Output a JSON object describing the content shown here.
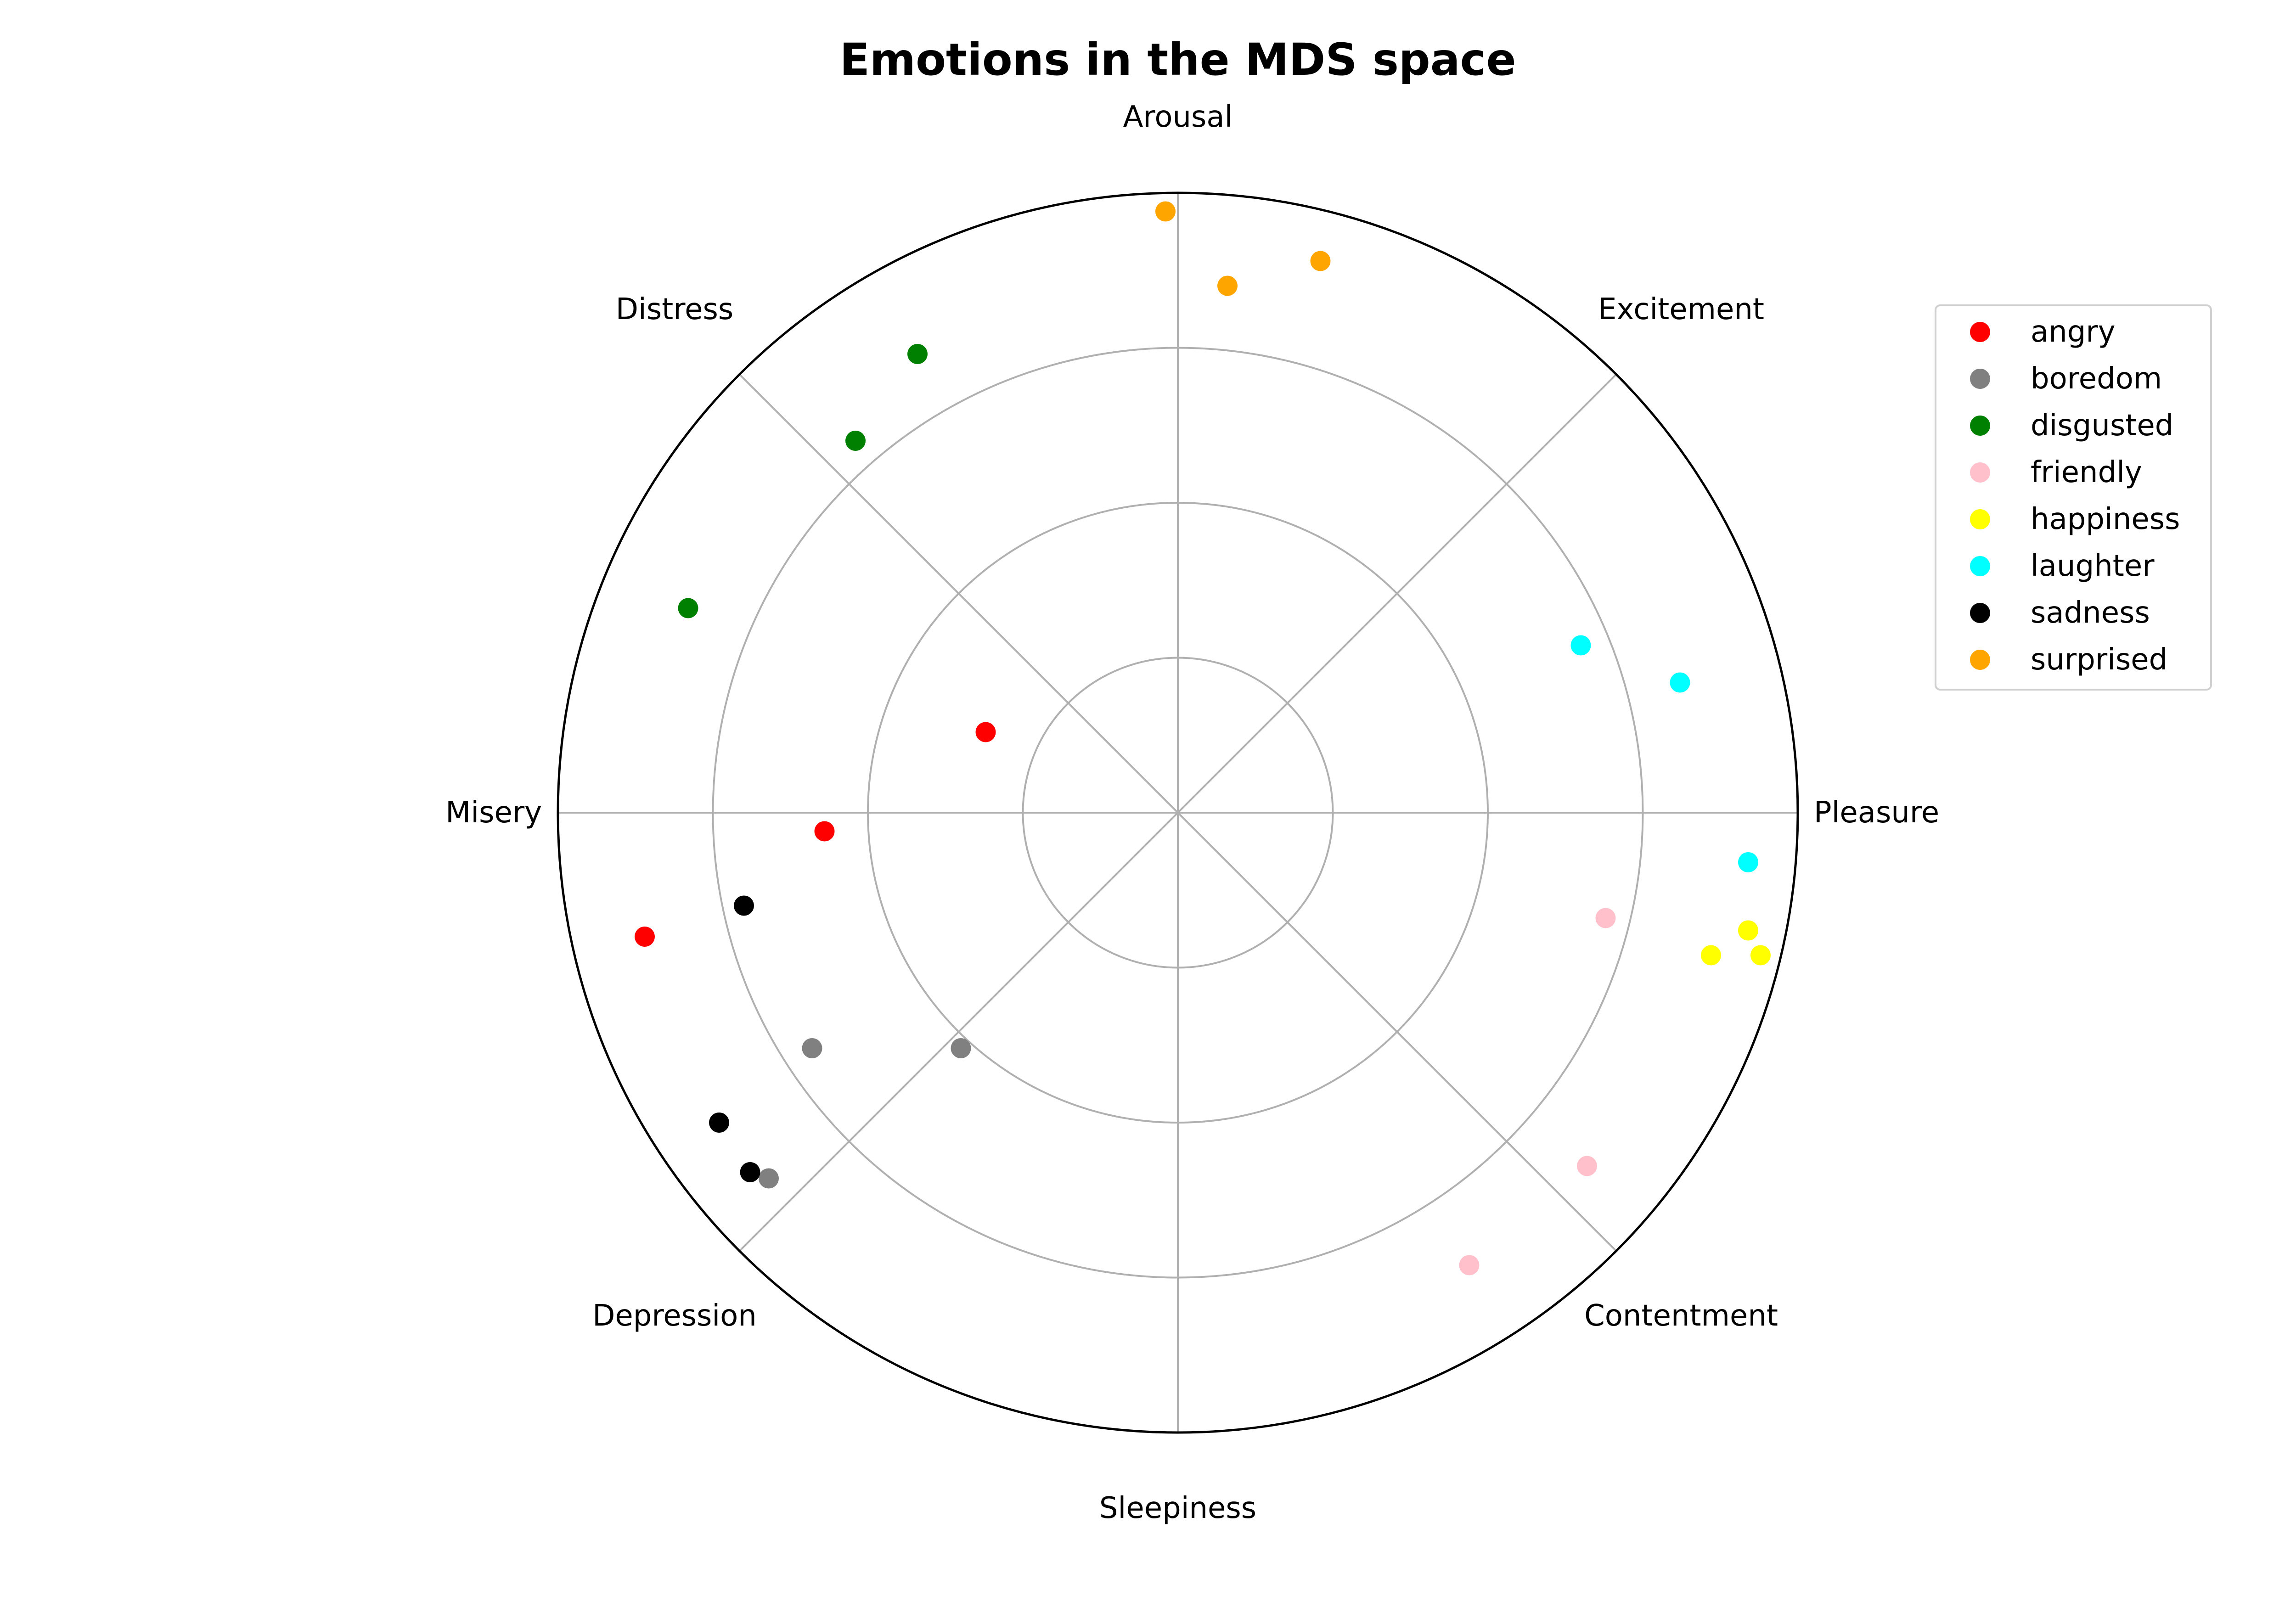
{
  "chart_data": {
    "type": "scatter",
    "coordinate_system": "polar",
    "title": "Emotions in the MDS space",
    "rmax": 1.0,
    "grid_rings": [
      0.25,
      0.5,
      0.75
    ],
    "grid": true,
    "legend_placement": "upper-right, outside plot",
    "axis_labels": [
      {
        "name": "Pleasure",
        "angle_deg": 0
      },
      {
        "name": "Excitement",
        "angle_deg": 45
      },
      {
        "name": "Arousal",
        "angle_deg": 90
      },
      {
        "name": "Distress",
        "angle_deg": 135
      },
      {
        "name": "Misery",
        "angle_deg": 180
      },
      {
        "name": "Depression",
        "angle_deg": 225
      },
      {
        "name": "Sleepiness",
        "angle_deg": 270
      },
      {
        "name": "Contentment",
        "angle_deg": 315
      }
    ],
    "series": [
      {
        "name": "angry",
        "color": "#ff0000",
        "points": [
          {
            "x": -0.31,
            "y": 0.13
          },
          {
            "x": -0.57,
            "y": -0.03
          },
          {
            "x": -0.86,
            "y": -0.2
          }
        ]
      },
      {
        "name": "boredom",
        "color": "#808080",
        "points": [
          {
            "x": -0.35,
            "y": -0.38
          },
          {
            "x": -0.59,
            "y": -0.38
          },
          {
            "x": -0.66,
            "y": -0.59
          }
        ]
      },
      {
        "name": "disgusted",
        "color": "#008000",
        "points": [
          {
            "x": -0.42,
            "y": 0.74
          },
          {
            "x": -0.52,
            "y": 0.6
          },
          {
            "x": -0.79,
            "y": 0.33
          }
        ]
      },
      {
        "name": "friendly",
        "color": "#ffc0cb",
        "points": [
          {
            "x": 0.69,
            "y": -0.17
          },
          {
            "x": 0.66,
            "y": -0.57
          },
          {
            "x": 0.47,
            "y": -0.73
          }
        ]
      },
      {
        "name": "happiness",
        "color": "#ffff00",
        "points": [
          {
            "x": 0.92,
            "y": -0.19
          },
          {
            "x": 0.86,
            "y": -0.23
          },
          {
            "x": 0.94,
            "y": -0.23
          }
        ]
      },
      {
        "name": "laughter",
        "color": "#00ffff",
        "points": [
          {
            "x": 0.65,
            "y": 0.27
          },
          {
            "x": 0.81,
            "y": 0.21
          },
          {
            "x": 0.92,
            "y": -0.08
          }
        ]
      },
      {
        "name": "sadness",
        "color": "#000000",
        "points": [
          {
            "x": -0.7,
            "y": -0.15
          },
          {
            "x": -0.74,
            "y": -0.5
          },
          {
            "x": -0.69,
            "y": -0.58
          }
        ]
      },
      {
        "name": "surprised",
        "color": "#ffa500",
        "points": [
          {
            "x": -0.02,
            "y": 0.97
          },
          {
            "x": 0.08,
            "y": 0.85
          },
          {
            "x": 0.23,
            "y": 0.89
          }
        ]
      }
    ]
  }
}
